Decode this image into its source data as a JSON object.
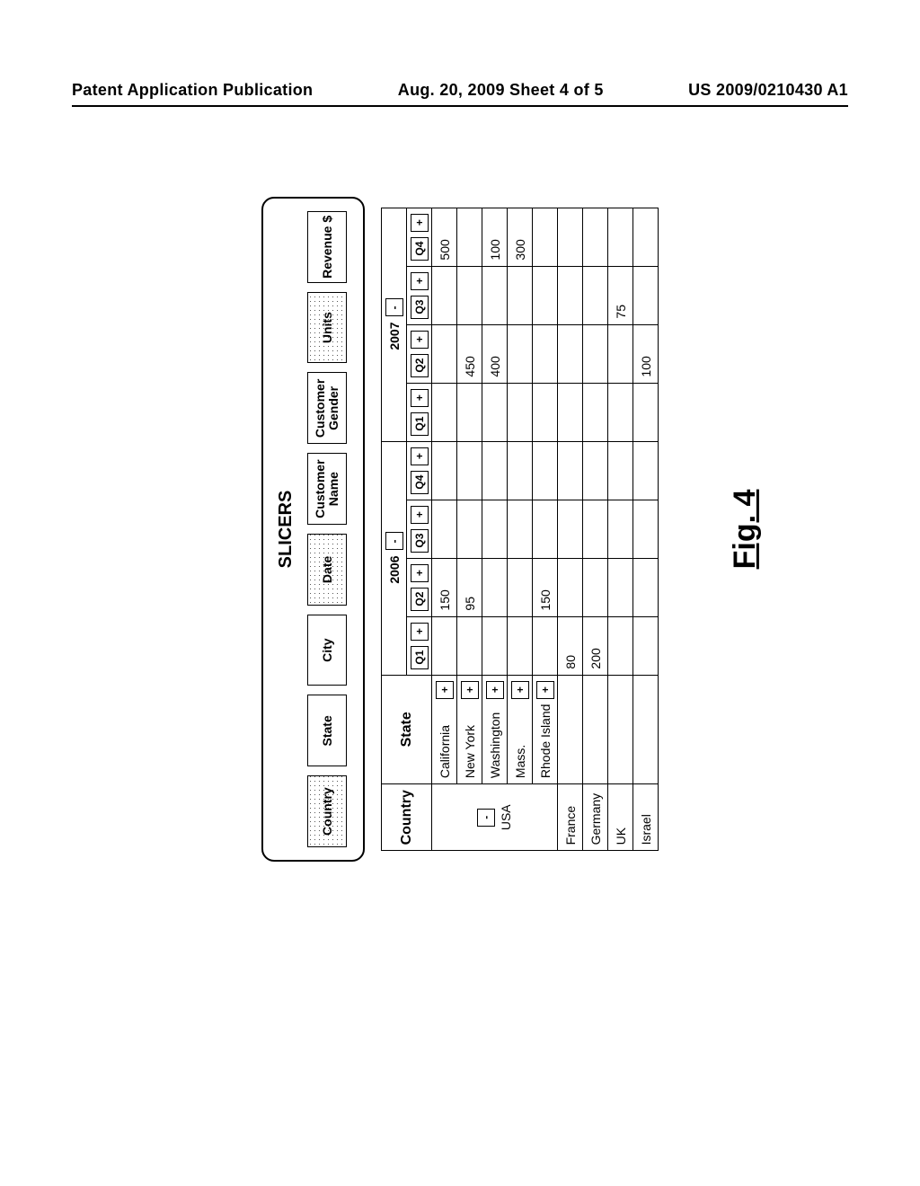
{
  "header": {
    "left": "Patent Application Publication",
    "center": "Aug. 20, 2009  Sheet 4 of 5",
    "right": "US 2009/0210430 A1"
  },
  "figure_label": "Fig. 4",
  "slicers": {
    "title": "SLICERS",
    "items": [
      {
        "label": "Country",
        "shaded": true
      },
      {
        "label": "State",
        "shaded": false
      },
      {
        "label": "City",
        "shaded": false
      },
      {
        "label": "Date",
        "shaded": true
      },
      {
        "label": "Customer Name",
        "shaded": false
      },
      {
        "label": "Customer Gender",
        "shaded": false
      },
      {
        "label": "Units",
        "shaded": true
      },
      {
        "label": "Revenue $",
        "shaded": false
      }
    ]
  },
  "pivot": {
    "row_headers": {
      "country": "Country",
      "state": "State"
    },
    "years": [
      {
        "label": "2006",
        "collapse": "-",
        "quarters": [
          "Q1",
          "Q2",
          "Q3",
          "Q4"
        ]
      },
      {
        "label": "2007",
        "collapse": "-",
        "quarters": [
          "Q1",
          "Q2",
          "Q3",
          "Q4"
        ]
      }
    ],
    "q_expand": "+",
    "countries": [
      {
        "name": "USA",
        "collapse": "-",
        "states": [
          {
            "name": "California",
            "expand": "+",
            "values": [
              "",
              "150",
              "",
              "",
              "",
              "",
              "",
              "500"
            ]
          },
          {
            "name": "New York",
            "expand": "+",
            "values": [
              "",
              "95",
              "",
              "",
              "",
              "450",
              "",
              ""
            ]
          },
          {
            "name": "Washington",
            "expand": "+",
            "values": [
              "",
              "",
              "",
              "",
              "",
              "400",
              "",
              "100"
            ]
          },
          {
            "name": "Mass.",
            "expand": "+",
            "values": [
              "",
              "",
              "",
              "",
              "",
              "",
              "",
              "300"
            ]
          },
          {
            "name": "Rhode Island",
            "expand": "+",
            "values": [
              "",
              "150",
              "",
              "",
              "",
              "",
              "",
              ""
            ]
          }
        ]
      },
      {
        "name": "France",
        "states": [],
        "values": [
          "80",
          "",
          "",
          "",
          "",
          "",
          "",
          ""
        ]
      },
      {
        "name": "Germany",
        "states": [],
        "values": [
          "200",
          "",
          "",
          "",
          "",
          "",
          "",
          ""
        ]
      },
      {
        "name": "UK",
        "states": [],
        "values": [
          "",
          "",
          "",
          "",
          "",
          "",
          "75",
          ""
        ]
      },
      {
        "name": "Israel",
        "states": [],
        "values": [
          "",
          "",
          "",
          "",
          "",
          "100",
          "",
          ""
        ]
      }
    ]
  }
}
